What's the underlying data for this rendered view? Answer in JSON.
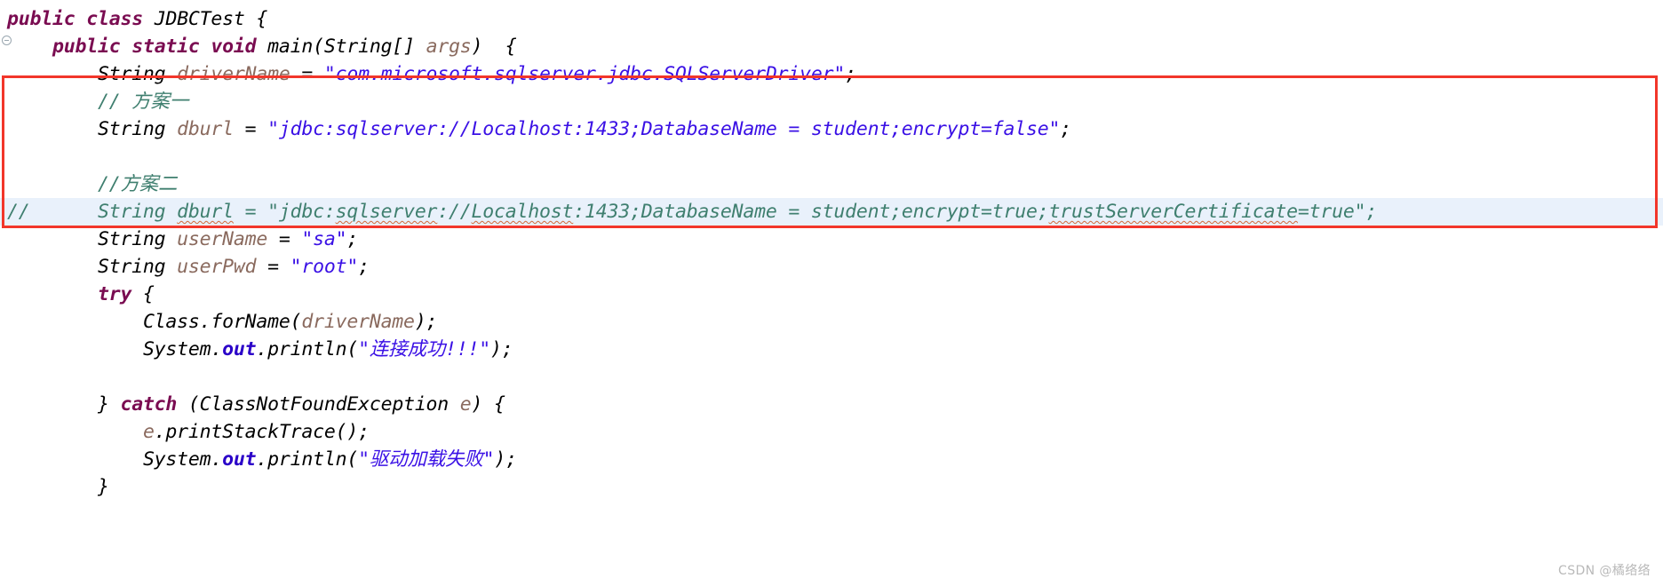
{
  "editor": {
    "language": "java",
    "class_name": "JDBCTest",
    "colors": {
      "keyword": "#7a0c51",
      "string": "#3a10e5",
      "comment": "#3f7f6f",
      "variable": "#8a6a5e",
      "static_field": "#2a00c8",
      "highlight_row_bg": "#e9f1fb",
      "annotation_box_border": "#f2362a",
      "background": "#ffffff",
      "text": "#000000"
    },
    "lines": [
      {
        "indent": "",
        "tokens": [
          {
            "t": "public",
            "c": "kw"
          },
          {
            "t": " ",
            "c": "plain"
          },
          {
            "t": "class",
            "c": "kw"
          },
          {
            "t": " ",
            "c": "plain"
          },
          {
            "t": "JDBCTest",
            "c": "plain"
          },
          {
            "t": " {",
            "c": "plain"
          }
        ]
      },
      {
        "indent": "    ",
        "tokens": [
          {
            "t": "public",
            "c": "kw"
          },
          {
            "t": " ",
            "c": "plain"
          },
          {
            "t": "static",
            "c": "kw"
          },
          {
            "t": " ",
            "c": "plain"
          },
          {
            "t": "void",
            "c": "kw"
          },
          {
            "t": " ",
            "c": "plain"
          },
          {
            "t": "main(String[] ",
            "c": "plain"
          },
          {
            "t": "args",
            "c": "var"
          },
          {
            "t": ")  {",
            "c": "plain"
          }
        ]
      },
      {
        "indent": "        ",
        "tokens": [
          {
            "t": "String ",
            "c": "plain"
          },
          {
            "t": "driverName",
            "c": "var"
          },
          {
            "t": " = ",
            "c": "plain"
          },
          {
            "t": "\"com.microsoft.sqlserver.jdbc.SQLServerDriver\"",
            "c": "str"
          },
          {
            "t": ";",
            "c": "plain"
          }
        ]
      },
      {
        "indent": "        ",
        "tokens": [
          {
            "t": "// 方案一",
            "c": "cmt"
          }
        ]
      },
      {
        "indent": "        ",
        "tokens": [
          {
            "t": "String ",
            "c": "plain"
          },
          {
            "t": "dburl",
            "c": "var"
          },
          {
            "t": " = ",
            "c": "plain"
          },
          {
            "t": "\"jdbc:sqlserver://Localhost:1433;DatabaseName = student;encrypt=false\"",
            "c": "str"
          },
          {
            "t": ";",
            "c": "plain"
          }
        ]
      },
      {
        "indent": "",
        "tokens": []
      },
      {
        "indent": "        ",
        "tokens": [
          {
            "t": "//方案二",
            "c": "cmt"
          }
        ]
      },
      {
        "indent": "",
        "highlighted": true,
        "commented_out": true,
        "tokens": [
          {
            "t": "//      String dburl = \"jdbc:sqlserver://Localhost:1433;DatabaseName = student;encrypt=true;trustServerCertificate=true\";",
            "c": "cmtline"
          }
        ]
      },
      {
        "indent": "        ",
        "tokens": [
          {
            "t": "String ",
            "c": "plain"
          },
          {
            "t": "userName",
            "c": "var"
          },
          {
            "t": " = ",
            "c": "plain"
          },
          {
            "t": "\"sa\"",
            "c": "str"
          },
          {
            "t": ";",
            "c": "plain"
          }
        ]
      },
      {
        "indent": "        ",
        "tokens": [
          {
            "t": "String ",
            "c": "plain"
          },
          {
            "t": "userPwd",
            "c": "var"
          },
          {
            "t": " = ",
            "c": "plain"
          },
          {
            "t": "\"root\"",
            "c": "str"
          },
          {
            "t": ";",
            "c": "plain"
          }
        ]
      },
      {
        "indent": "        ",
        "tokens": [
          {
            "t": "try",
            "c": "kw"
          },
          {
            "t": " {",
            "c": "plain"
          }
        ]
      },
      {
        "indent": "            ",
        "tokens": [
          {
            "t": "Class.forName(",
            "c": "plain"
          },
          {
            "t": "driverName",
            "c": "var"
          },
          {
            "t": ");",
            "c": "plain"
          }
        ]
      },
      {
        "indent": "            ",
        "tokens": [
          {
            "t": "System.",
            "c": "plain"
          },
          {
            "t": "out",
            "c": "fld"
          },
          {
            "t": ".println(",
            "c": "plain"
          },
          {
            "t": "\"连接成功!!!\"",
            "c": "str"
          },
          {
            "t": ");",
            "c": "plain"
          }
        ]
      },
      {
        "indent": "",
        "tokens": []
      },
      {
        "indent": "        ",
        "tokens": [
          {
            "t": "} ",
            "c": "plain"
          },
          {
            "t": "catch",
            "c": "kw"
          },
          {
            "t": " (ClassNotFoundException ",
            "c": "plain"
          },
          {
            "t": "e",
            "c": "var"
          },
          {
            "t": ") {",
            "c": "plain"
          }
        ]
      },
      {
        "indent": "            ",
        "tokens": [
          {
            "t": "e",
            "c": "var"
          },
          {
            "t": ".printStackTrace();",
            "c": "plain"
          }
        ]
      },
      {
        "indent": "            ",
        "tokens": [
          {
            "t": "System.",
            "c": "plain"
          },
          {
            "t": "out",
            "c": "fld"
          },
          {
            "t": ".println(",
            "c": "plain"
          },
          {
            "t": "\"驱动加载失败\"",
            "c": "str"
          },
          {
            "t": ");",
            "c": "plain"
          }
        ]
      },
      {
        "indent": "        ",
        "tokens": [
          {
            "t": "}",
            "c": "plain"
          }
        ]
      }
    ]
  },
  "annotation": {
    "type": "red-rectangle",
    "label": "highlighted-region",
    "covers_lines": "// 方案一 through the commented 方案二 connection string"
  },
  "watermark": {
    "text": "CSDN @橘络络"
  }
}
